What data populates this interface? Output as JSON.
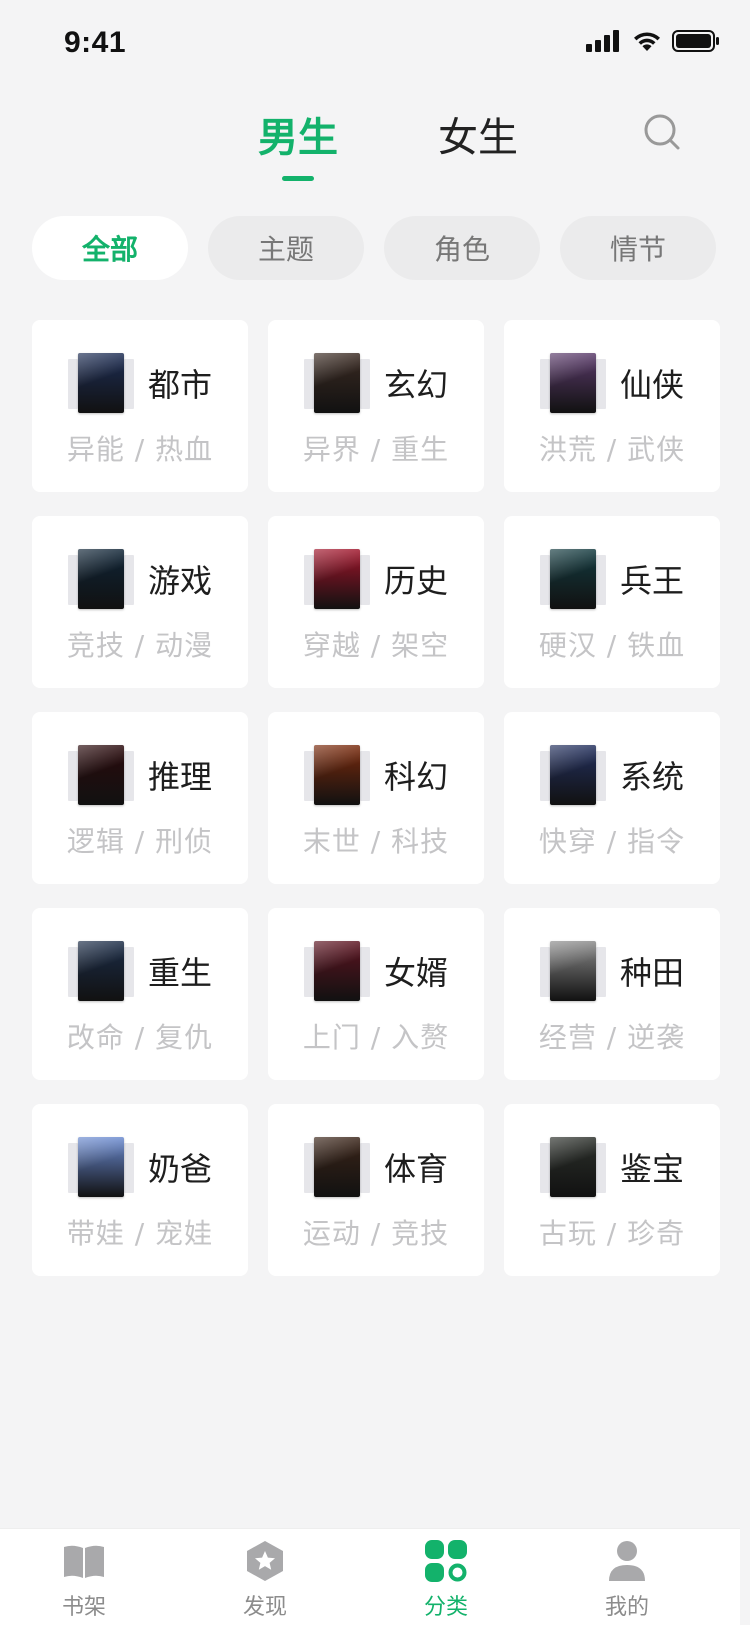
{
  "status_bar": {
    "time": "9:41"
  },
  "gender_tabs": [
    {
      "label": "男生",
      "active": true
    },
    {
      "label": "女生",
      "active": false
    }
  ],
  "filters": [
    {
      "label": "全部",
      "active": true
    },
    {
      "label": "主题",
      "active": false
    },
    {
      "label": "角色",
      "active": false
    },
    {
      "label": "情节",
      "active": false
    }
  ],
  "categories": [
    {
      "title": "都市",
      "sub": "异能 / 热血",
      "cover_color": "#1d2d54",
      "cover_text": ""
    },
    {
      "title": "玄幻",
      "sub": "异界 / 重生",
      "cover_color": "#3a2a22",
      "cover_text": ""
    },
    {
      "title": "仙侠",
      "sub": "洪荒 / 武侠",
      "cover_color": "#5a3a6a",
      "cover_text": ""
    },
    {
      "title": "游戏",
      "sub": "竞技 / 动漫",
      "cover_color": "#0f2436",
      "cover_text": ""
    },
    {
      "title": "历史",
      "sub": "穿越 / 架空",
      "cover_color": "#a0142a",
      "cover_text": ""
    },
    {
      "title": "兵王",
      "sub": "硬汉 / 铁血",
      "cover_color": "#133a3f",
      "cover_text": ""
    },
    {
      "title": "推理",
      "sub": "逻辑 / 刑侦",
      "cover_color": "#2a0a0c",
      "cover_text": ""
    },
    {
      "title": "科幻",
      "sub": "末世 / 科技",
      "cover_color": "#7a2a0c",
      "cover_text": ""
    },
    {
      "title": "系统",
      "sub": "快穿 / 指令",
      "cover_color": "#23305e",
      "cover_text": ""
    },
    {
      "title": "重生",
      "sub": "改命 / 复仇",
      "cover_color": "#1b2c47",
      "cover_text": ""
    },
    {
      "title": "女婿",
      "sub": "上门 / 入赘",
      "cover_color": "#5c1320",
      "cover_text": ""
    },
    {
      "title": "种田",
      "sub": "经营 / 逆袭",
      "cover_color": "#8a8a8a",
      "cover_text": ""
    },
    {
      "title": "奶爸",
      "sub": "带娃 / 宠娃",
      "cover_color": "#6a8ad0",
      "cover_text": ""
    },
    {
      "title": "体育",
      "sub": "运动 / 竞技",
      "cover_color": "#3a2418",
      "cover_text": ""
    },
    {
      "title": "鉴宝",
      "sub": "古玩 / 珍奇",
      "cover_color": "#2b2f2a",
      "cover_text": ""
    }
  ],
  "tabbar": [
    {
      "label": "书架",
      "icon": "book-icon",
      "active": false
    },
    {
      "label": "发现",
      "icon": "star-hexagon-icon",
      "active": false
    },
    {
      "label": "分类",
      "icon": "category-grid-icon",
      "active": true
    },
    {
      "label": "我的",
      "icon": "person-icon",
      "active": false
    }
  ],
  "colors": {
    "accent": "#13b26b",
    "background": "#f4f4f5",
    "muted": "#c4c4c6"
  }
}
